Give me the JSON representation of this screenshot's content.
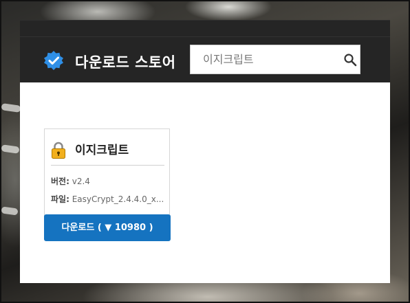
{
  "header": {
    "title": "다운로드 스토어",
    "brand_icon": "verified-badge-icon"
  },
  "search": {
    "value": "",
    "placeholder": "이지크립트",
    "icon": "search-icon"
  },
  "card": {
    "icon": "lock-icon",
    "title": "이지크립트",
    "version_label": "버전:",
    "version_value": "v2.4",
    "file_label": "파일:",
    "file_value": "EasyCrypt_2.4.4.0_x...",
    "download_label": "다운로드 ( ▼ 10980 )"
  },
  "colors": {
    "header_bg": "#252525",
    "accent": "#1573c0",
    "badge": "#2f8fe6"
  }
}
